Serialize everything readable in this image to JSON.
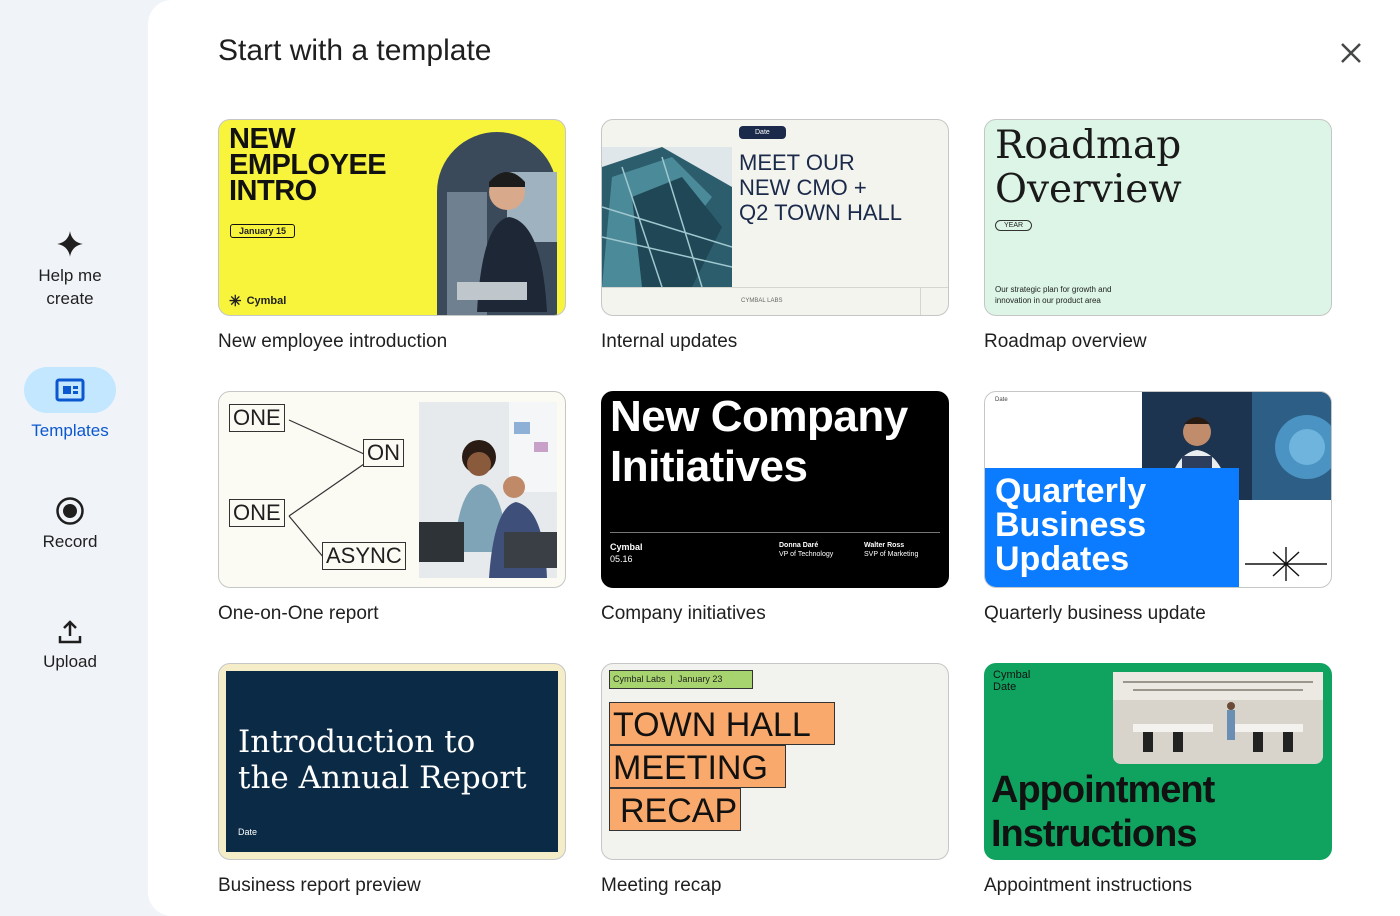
{
  "rail": {
    "help": "Help me create",
    "help_l1": "Help me",
    "help_l2": "create",
    "templates": "Templates",
    "record": "Record",
    "upload": "Upload"
  },
  "header": {
    "title": "Start with a template"
  },
  "colors": {
    "accent": "#0b57d0",
    "pill": "#c2e7ff",
    "yellow": "#f8f43c",
    "mint": "#dcf5e6",
    "blue": "#0b7cff",
    "navy": "#0b2a45",
    "green": "#0fa35f",
    "orange": "#f9a96b"
  },
  "templates": [
    {
      "name": "New employee introduction",
      "t1": "NEW",
      "t2": "EMPLOYEE",
      "t3": "INTRO",
      "date": "January 15",
      "brand": "Cymbal"
    },
    {
      "name": "Internal updates",
      "badge": "Date",
      "t1": "MEET OUR",
      "t2": "NEW CMO +",
      "t3": "Q2 TOWN HALL",
      "footer": "CYMBAL LABS"
    },
    {
      "name": "Roadmap overview",
      "t1": "Roadmap",
      "t2": "Overview",
      "badge": "YEAR",
      "desc1": "Our strategic plan for growth and",
      "desc2": "innovation in our product area"
    },
    {
      "name": "One-on-One report",
      "w1": "ONE",
      "w2": "ON",
      "w3": "ONE",
      "w4": "ASYNC"
    },
    {
      "name": "Company initiatives",
      "t1": "New Company",
      "t2": "Initiatives",
      "brand": "Cymbal",
      "date": "05.16",
      "p1": "Donna Daré",
      "r1": "VP of Technology",
      "p2": "Walter Ross",
      "r2": "SVP of Marketing"
    },
    {
      "name": "Quarterly business update",
      "date": "Date",
      "t1": "Quarterly",
      "t2": "Business",
      "t3": "Updates"
    },
    {
      "name": "Business report preview",
      "t1": "Introduction to",
      "t2": "the Annual Report",
      "date": "Date"
    },
    {
      "name": "Meeting recap",
      "tag": "Cymbal Labs  |  January 23",
      "t1": "TOWN HALL",
      "t2": "MEETING",
      "t3": "RECAP"
    },
    {
      "name": "Appointment instructions",
      "brand": "Cymbal",
      "date": "Date",
      "t1": "Appointment",
      "t2": "Instructions"
    }
  ]
}
